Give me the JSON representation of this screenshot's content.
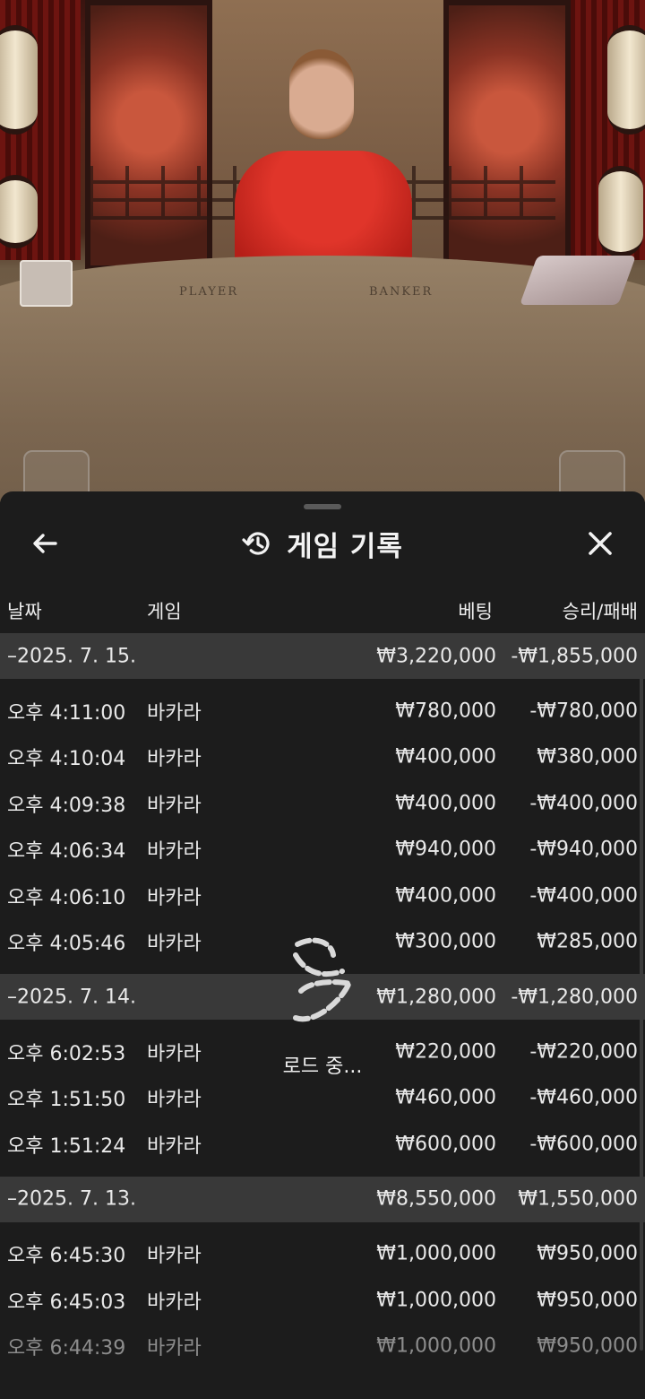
{
  "video": {
    "table_labels": [
      "PLAYER",
      "BANKER"
    ]
  },
  "sheet": {
    "title": "게임 기록",
    "icons": {
      "back": "arrow-left-icon",
      "history": "history-icon",
      "close": "close-icon",
      "loading": "loading-spinner-icon"
    },
    "columns": {
      "date": "날짜",
      "game": "게임",
      "bet": "베팅",
      "win_loss": "승리/패배"
    },
    "groups": [
      {
        "date": "–2025. 7. 15.",
        "bet": "₩3,220,000",
        "win_loss": "-₩1,855,000",
        "rows": [
          {
            "time": "오후 4:11:00",
            "game": "바카라",
            "bet": "₩780,000",
            "win_loss": "-₩780,000"
          },
          {
            "time": "오후 4:10:04",
            "game": "바카라",
            "bet": "₩400,000",
            "win_loss": "₩380,000"
          },
          {
            "time": "오후 4:09:38",
            "game": "바카라",
            "bet": "₩400,000",
            "win_loss": "-₩400,000"
          },
          {
            "time": "오후 4:06:34",
            "game": "바카라",
            "bet": "₩940,000",
            "win_loss": "-₩940,000"
          },
          {
            "time": "오후 4:06:10",
            "game": "바카라",
            "bet": "₩400,000",
            "win_loss": "-₩400,000"
          },
          {
            "time": "오후 4:05:46",
            "game": "바카라",
            "bet": "₩300,000",
            "win_loss": "₩285,000"
          }
        ]
      },
      {
        "date": "–2025. 7. 14.",
        "bet": "₩1,280,000",
        "win_loss": "-₩1,280,000",
        "rows": [
          {
            "time": "오후 6:02:53",
            "game": "바카라",
            "bet": "₩220,000",
            "win_loss": "-₩220,000"
          },
          {
            "time": "오후 1:51:50",
            "game": "바카라",
            "bet": "₩460,000",
            "win_loss": "-₩460,000"
          },
          {
            "time": "오후 1:51:24",
            "game": "바카라",
            "bet": "₩600,000",
            "win_loss": "-₩600,000"
          }
        ]
      },
      {
        "date": "–2025. 7. 13.",
        "bet": "₩8,550,000",
        "win_loss": "₩1,550,000",
        "rows": [
          {
            "time": "오후 6:45:30",
            "game": "바카라",
            "bet": "₩1,000,000",
            "win_loss": "₩950,000"
          },
          {
            "time": "오후 6:45:03",
            "game": "바카라",
            "bet": "₩1,000,000",
            "win_loss": "₩950,000"
          },
          {
            "time": "오후 6:44:39",
            "game": "바카라",
            "bet": "₩1,000,000",
            "win_loss": "₩950,000"
          }
        ]
      }
    ],
    "loading_text": "로드 중..."
  }
}
